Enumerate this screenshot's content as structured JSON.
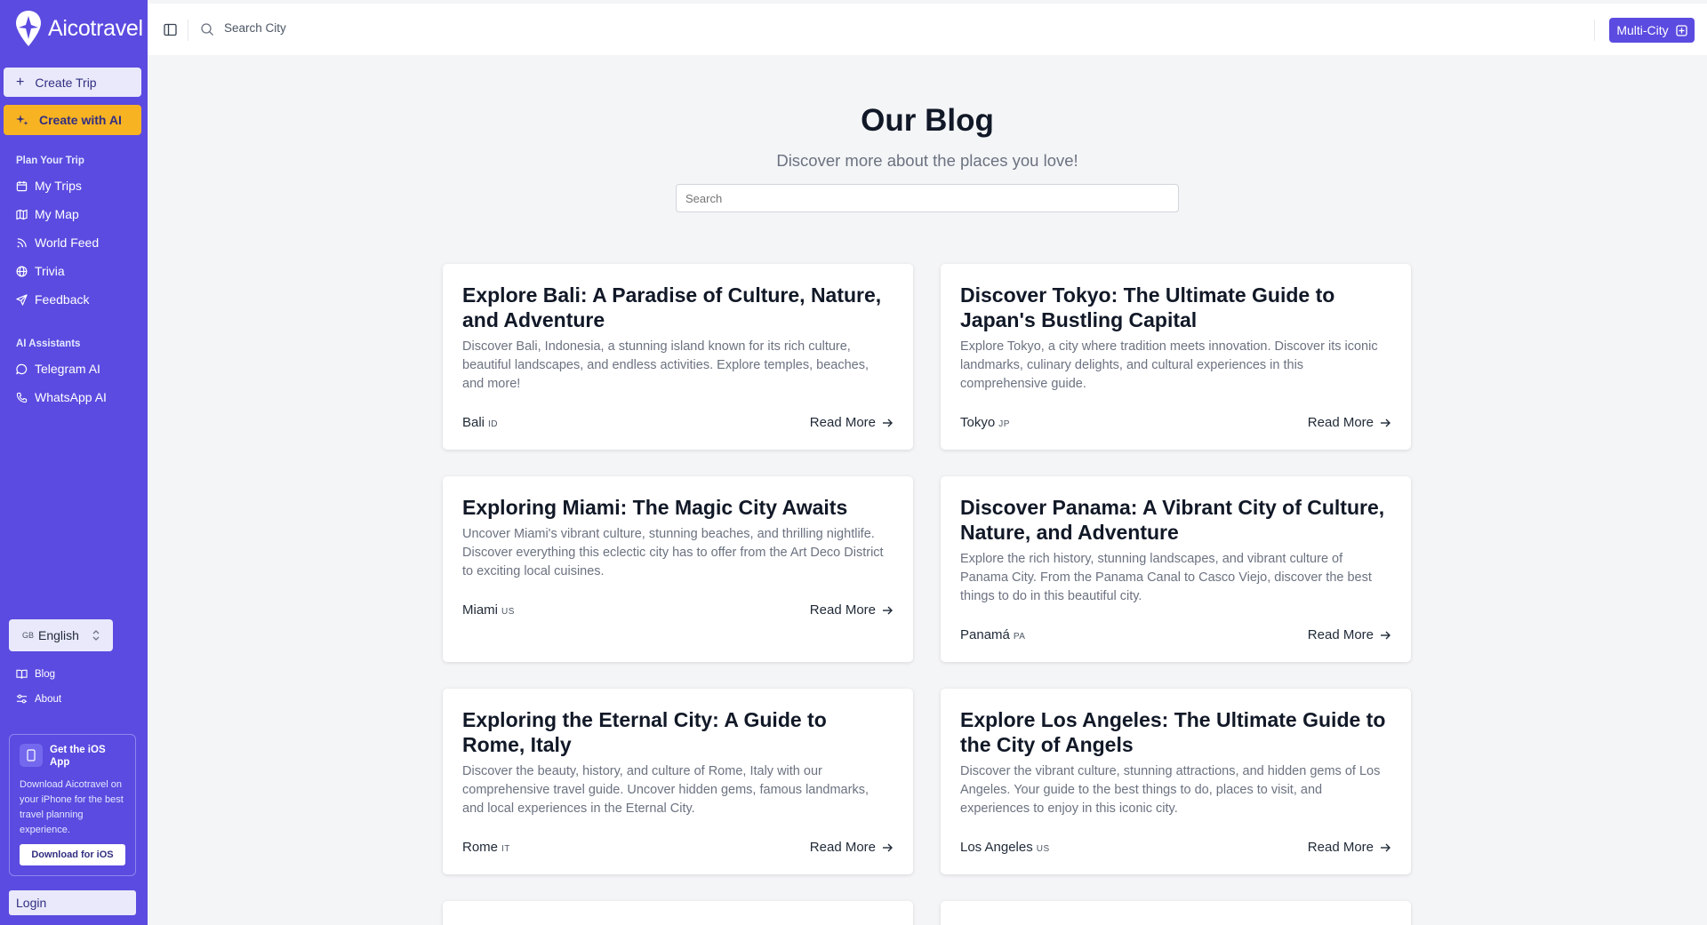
{
  "app": {
    "name": "Aicotravel"
  },
  "sidebar": {
    "create_trip": "Create Trip",
    "create_ai": "Create with AI",
    "plan_label": "Plan Your Trip",
    "plan_items": [
      {
        "label": "My Trips",
        "icon": "calendar-icon"
      },
      {
        "label": "My Map",
        "icon": "map-icon"
      },
      {
        "label": "World Feed",
        "icon": "rss-icon"
      },
      {
        "label": "Trivia",
        "icon": "globe-icon"
      },
      {
        "label": "Feedback",
        "icon": "send-icon"
      }
    ],
    "ai_label": "AI Assistants",
    "ai_items": [
      {
        "label": "Telegram AI",
        "icon": "chat-icon"
      },
      {
        "label": "WhatsApp AI",
        "icon": "phone-icon"
      }
    ],
    "language": {
      "flag": "GB",
      "label": "English"
    },
    "footer_links": [
      {
        "label": "Blog",
        "icon": "book-icon"
      },
      {
        "label": "About",
        "icon": "sliders-icon"
      }
    ],
    "ios": {
      "title": "Get the iOS App",
      "description": "Download Aicotravel on your iPhone for the best travel planning experience.",
      "button": "Download for iOS"
    },
    "login": "Login"
  },
  "topbar": {
    "search_placeholder": "Search City",
    "multi_city": "Multi-City"
  },
  "main": {
    "title": "Our Blog",
    "subtitle": "Discover more about the places you love!",
    "search_placeholder": "Search",
    "read_more": "Read More",
    "posts": [
      {
        "title": "Explore Bali: A Paradise of Culture, Nature, and Adventure",
        "description": "Discover Bali, Indonesia, a stunning island known for its rich culture, beautiful landscapes, and endless activities. Explore temples, beaches, and more!",
        "city": "Bali",
        "country": "ID"
      },
      {
        "title": "Discover Tokyo: The Ultimate Guide to Japan's Bustling Capital",
        "description": "Explore Tokyo, a city where tradition meets innovation. Discover its iconic landmarks, culinary delights, and cultural experiences in this comprehensive guide.",
        "city": "Tokyo",
        "country": "JP"
      },
      {
        "title": "Exploring Miami: The Magic City Awaits",
        "description": "Uncover Miami's vibrant culture, stunning beaches, and thrilling nightlife. Discover everything this eclectic city has to offer from the Art Deco District to exciting local cuisines.",
        "city": "Miami",
        "country": "US"
      },
      {
        "title": "Discover Panama: A Vibrant City of Culture, Nature, and Adventure",
        "description": "Explore the rich history, stunning landscapes, and vibrant culture of Panama City. From the Panama Canal to Casco Viejo, discover the best things to do in this beautiful city.",
        "city": "Panamá",
        "country": "PA"
      },
      {
        "title": "Exploring the Eternal City: A Guide to Rome, Italy",
        "description": "Discover the beauty, history, and culture of Rome, Italy with our comprehensive travel guide. Uncover hidden gems, famous landmarks, and local experiences in the Eternal City.",
        "city": "Rome",
        "country": "IT"
      },
      {
        "title": "Explore Los Angeles: The Ultimate Guide to the City of Angels",
        "description": "Discover the vibrant culture, stunning attractions, and hidden gems of Los Angeles. Your guide to the best things to do, places to visit, and experiences to enjoy in this iconic city.",
        "city": "Los Angeles",
        "country": "US"
      }
    ]
  },
  "colors": {
    "sidebar": "#5b4be0",
    "accent_yellow": "#f8b323",
    "background": "#f4f5f7"
  }
}
